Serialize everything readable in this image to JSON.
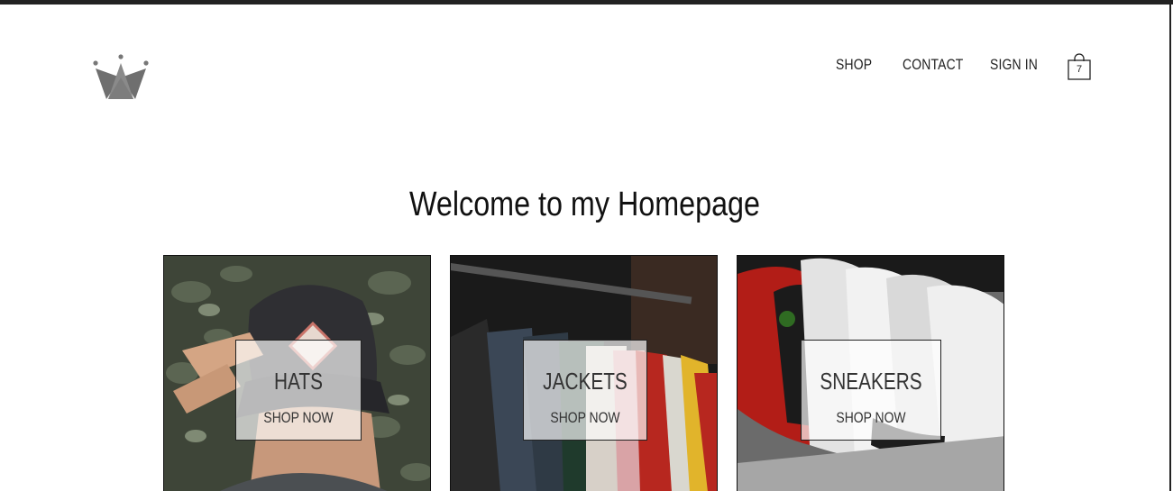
{
  "header": {
    "logo_icon": "crown-icon",
    "nav": [
      {
        "label": "SHOP"
      },
      {
        "label": "CONTACT"
      },
      {
        "label": "SIGN IN"
      }
    ],
    "cart": {
      "icon": "shopping-bag-icon",
      "count": "7"
    }
  },
  "main": {
    "title": "Welcome to my Homepage",
    "categories": [
      {
        "title": "HATS",
        "cta": "SHOP NOW",
        "image": "cap-photo"
      },
      {
        "title": "JACKETS",
        "cta": "SHOP NOW",
        "image": "jackets-photo"
      },
      {
        "title": "SNEAKERS",
        "cta": "SHOP NOW",
        "image": "sneakers-photo"
      }
    ]
  },
  "colors": {
    "accent": "#222222",
    "background": "#ffffff",
    "logo": "#6b6b6b"
  }
}
